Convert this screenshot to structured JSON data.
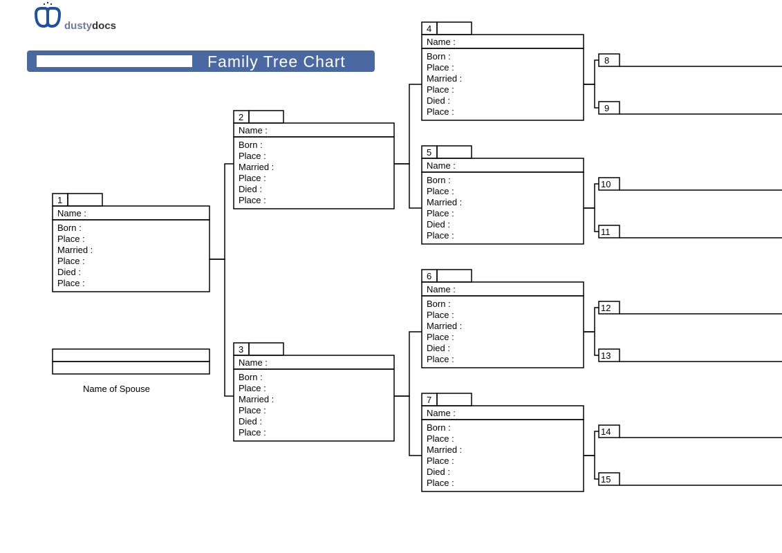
{
  "brand": {
    "dusty": "dusty",
    "docs": "docs"
  },
  "title": "Family Tree Chart",
  "spouse_label": "Name of Spouse",
  "fields": [
    "Born :",
    "Place :",
    "Married :",
    "Place :",
    "Died :",
    "Place :"
  ],
  "name_label": "Name :",
  "boxes": {
    "1": "1",
    "2": "2",
    "3": "3",
    "4": "4",
    "5": "5",
    "6": "6",
    "7": "7",
    "8": "8",
    "9": "9",
    "10": "10",
    "11": "11",
    "12": "12",
    "13": "13",
    "14": "14",
    "15": "15"
  }
}
